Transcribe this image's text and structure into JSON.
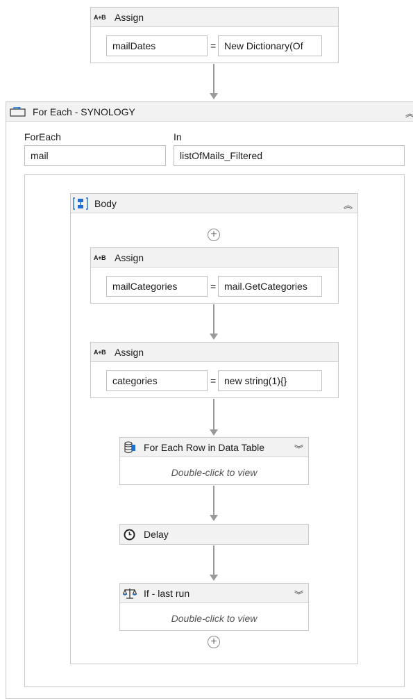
{
  "assign_top": {
    "title": "Assign",
    "icon_text": "A+B",
    "to": "mailDates",
    "eq": "=",
    "value": "New Dictionary(Of"
  },
  "foreach": {
    "title": "For Each - SYNOLOGY",
    "foreach_label": "ForEach",
    "foreach_value": "mail",
    "in_label": "In",
    "in_value": "listOfMails_Filtered",
    "collapse_glyph": "︽"
  },
  "body": {
    "title": "Body",
    "collapse_glyph": "︽",
    "add_glyph": "+"
  },
  "assign_categories": {
    "title": "Assign",
    "icon_text": "A+B",
    "to": "mailCategories",
    "eq": "=",
    "value": "mail.GetCategories"
  },
  "assign_new": {
    "title": "Assign",
    "icon_text": "A+B",
    "to": "categories",
    "eq": "=",
    "value": "new string(1){}"
  },
  "foreach_row": {
    "title": "For Each Row in Data Table",
    "expand_glyph": "︾",
    "hint": "Double-click to view"
  },
  "delay": {
    "title": "Delay"
  },
  "if_last": {
    "title": "If - last run",
    "expand_glyph": "︾",
    "hint": "Double-click to view"
  },
  "colors": {
    "header_bg": "#f2f2f2",
    "border": "#c8c8c8",
    "arrow": "#9a9a9a",
    "accent_blue": "#1e6fd0"
  }
}
